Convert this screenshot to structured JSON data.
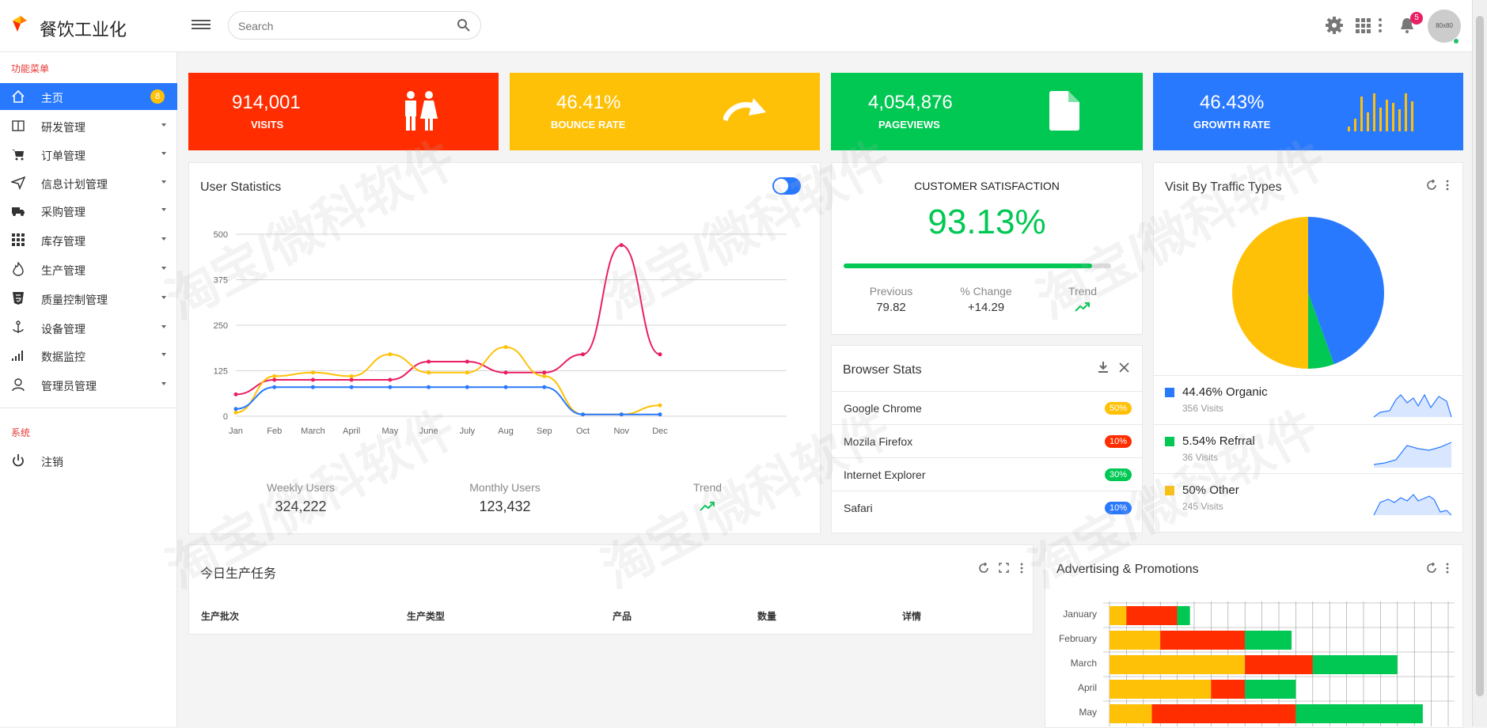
{
  "app": {
    "brand": "餐饮工业化"
  },
  "search": {
    "placeholder": "Search"
  },
  "header": {
    "notification_count": "5",
    "avatar_text": "80x80"
  },
  "sidebar": {
    "section1": "功能菜单",
    "items": [
      {
        "label": "主页",
        "badge": "8"
      },
      {
        "label": "研发管理"
      },
      {
        "label": "订单管理"
      },
      {
        "label": "信息计划管理"
      },
      {
        "label": "采购管理"
      },
      {
        "label": "库存管理"
      },
      {
        "label": "生产管理"
      },
      {
        "label": "质量控制管理"
      },
      {
        "label": "设备管理"
      },
      {
        "label": "数据监控"
      },
      {
        "label": "管理员管理"
      }
    ],
    "section2": "系统",
    "logout": "注销"
  },
  "stats": [
    {
      "value": "914,001",
      "label": "VISITS",
      "color": "#ff2d00"
    },
    {
      "value": "46.41%",
      "label": "BOUNCE RATE",
      "color": "#ffc107"
    },
    {
      "value": "4,054,876",
      "label": "PAGEVIEWS",
      "color": "#00c853"
    },
    {
      "value": "46.43%",
      "label": "GROWTH RATE",
      "color": "#2979ff"
    }
  ],
  "user_stats": {
    "title": "User Statistics",
    "weekly_label": "Weekly Users",
    "weekly_value": "324,222",
    "monthly_label": "Monthly Users",
    "monthly_value": "123,432",
    "trend_label": "Trend"
  },
  "chart_data": [
    {
      "type": "line",
      "categories": [
        "Jan",
        "Feb",
        "March",
        "April",
        "May",
        "June",
        "July",
        "Aug",
        "Sep",
        "Oct",
        "Nov",
        "Dec"
      ],
      "ylim": [
        0,
        500
      ],
      "yticks": [
        0,
        125,
        250,
        375,
        500
      ],
      "series": [
        {
          "color": "#e91e63",
          "values": [
            60,
            100,
            100,
            100,
            100,
            150,
            150,
            120,
            120,
            170,
            470,
            170
          ]
        },
        {
          "color": "#ffc107",
          "values": [
            10,
            110,
            120,
            110,
            170,
            120,
            120,
            190,
            110,
            5,
            5,
            30
          ]
        },
        {
          "color": "#2979ff",
          "values": [
            20,
            80,
            80,
            80,
            80,
            80,
            80,
            80,
            80,
            5,
            5,
            5
          ]
        }
      ]
    },
    {
      "type": "pie",
      "slices": [
        {
          "label": "Organic",
          "value": 44.46,
          "color": "#2979ff"
        },
        {
          "label": "Refrral",
          "value": 5.54,
          "color": "#00c853"
        },
        {
          "label": "Other",
          "value": 50,
          "color": "#ffc107"
        }
      ]
    },
    {
      "type": "bar",
      "orientation": "horizontal",
      "stacked": true,
      "categories": [
        "January",
        "February",
        "March",
        "April",
        "May"
      ],
      "series": [
        {
          "color": "#ffc107",
          "values": [
            2,
            6,
            16,
            12,
            5
          ]
        },
        {
          "color": "#ff2d00",
          "values": [
            6,
            10,
            8,
            4,
            17
          ]
        },
        {
          "color": "#00c853",
          "values": [
            1.5,
            5.5,
            10,
            6,
            15
          ]
        }
      ],
      "xlim": [
        0,
        40
      ]
    }
  ],
  "satisfaction": {
    "title": "CUSTOMER SATISFACTION",
    "value": "93.13%",
    "progress": 0.93,
    "previous_label": "Previous",
    "previous_value": "79.82",
    "change_label": "% Change",
    "change_value": "+14.29",
    "trend_label": "Trend"
  },
  "browser_stats": {
    "title": "Browser Stats",
    "rows": [
      {
        "name": "Google Chrome",
        "pct": "50%",
        "color": "#ffc107"
      },
      {
        "name": "Mozila Firefox",
        "pct": "10%",
        "color": "#ff2d00"
      },
      {
        "name": "Internet Explorer",
        "pct": "30%",
        "color": "#00c853"
      },
      {
        "name": "Safari",
        "pct": "10%",
        "color": "#2979ff"
      }
    ]
  },
  "traffic": {
    "title": "Visit By Traffic Types",
    "rows": [
      {
        "pct": "44.46% Organic",
        "visits": "356 Visits",
        "color": "#2979ff"
      },
      {
        "pct": "5.54% Refrral",
        "visits": "36 Visits",
        "color": "#00c853"
      },
      {
        "pct": "50% Other",
        "visits": "245 Visits",
        "color": "#ffc107"
      }
    ]
  },
  "production": {
    "title": "今日生产任务",
    "headers": [
      "生产批次",
      "生产类型",
      "产品",
      "数量",
      "详情"
    ]
  },
  "ads": {
    "title": "Advertising & Promotions"
  },
  "watermark": "淘宝/微科软件"
}
